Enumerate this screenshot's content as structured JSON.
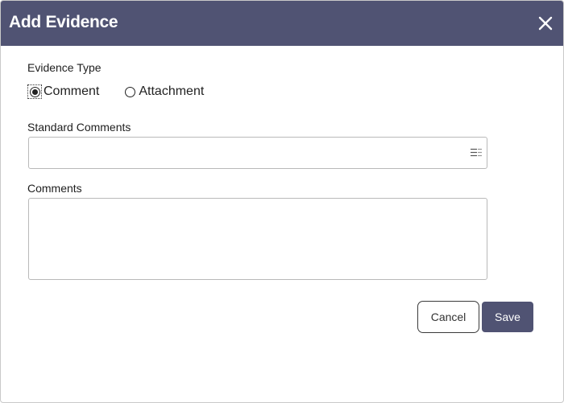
{
  "dialog": {
    "title": "Add Evidence",
    "close_icon": "close-icon"
  },
  "evidence_type": {
    "label": "Evidence Type",
    "options": [
      {
        "label": "Comment",
        "selected": true
      },
      {
        "label": "Attachment",
        "selected": false
      }
    ]
  },
  "standard_comments": {
    "label": "Standard Comments",
    "value": "",
    "icon": "list-icon"
  },
  "comments": {
    "label": "Comments",
    "value": ""
  },
  "buttons": {
    "cancel": "Cancel",
    "save": "Save"
  },
  "colors": {
    "header": "#505373",
    "primary_button": "#505373"
  }
}
